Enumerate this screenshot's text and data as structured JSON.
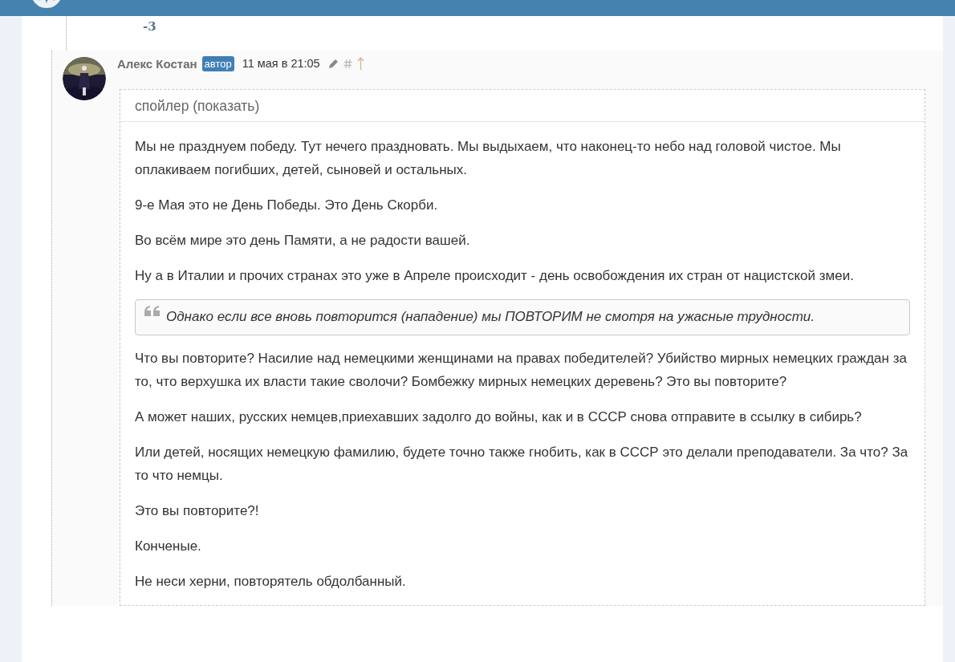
{
  "previous_comment": {
    "score": "-3"
  },
  "comment": {
    "author": "Алекс Костан",
    "badge": "автор",
    "time": "11 мая в 21:05",
    "spoiler": {
      "toggle": "спойлер (показать)"
    },
    "blocks": [
      {
        "kind": "paragraph",
        "text": "Мы не празднуем победу. Тут нечего праздновать. Мы выдыхаем, что наконец-то небо над головой чистое. Мы оплакиваем погибших, детей, сыновей и остальных."
      },
      {
        "kind": "paragraph",
        "text": "9-е Мая это не День Победы. Это День Скорби."
      },
      {
        "kind": "paragraph",
        "text": "Во всём мире это день Памяти, а не радости вашей."
      },
      {
        "kind": "paragraph",
        "text": "Ну а в Италии и прочих странах это уже в Апреле происходит - день освобождения их стран от нацистской змеи."
      },
      {
        "kind": "quote",
        "text": "Однако если все вновь повторится (нападение) мы ПОВТОРИМ не смотря на ужасные трудности."
      },
      {
        "kind": "paragraph",
        "text": "Что вы повторите? Насилие над немецкими женщинами на правах победителей? Убийство мирных немецких граждан за то, что верхушка их власти такие сволочи? Бомбежку мирных немецких деревень? Это вы повторите?"
      },
      {
        "kind": "paragraph",
        "text": "А может наших, русских немцев,приехавших задолго до войны, как и в СССР снова отправите в ссылку в сибирь?"
      },
      {
        "kind": "paragraph",
        "text": "Или детей, носящих немецкую фамилию, будете точно также гнобить, как в СССР это делали преподаватели. За что? За то что немцы."
      },
      {
        "kind": "paragraph",
        "text": "Это вы повторите?!"
      },
      {
        "kind": "paragraph",
        "text": "Конченые."
      },
      {
        "kind": "paragraph",
        "text": "Не неси херни, повторятель обдолбанный."
      }
    ]
  }
}
